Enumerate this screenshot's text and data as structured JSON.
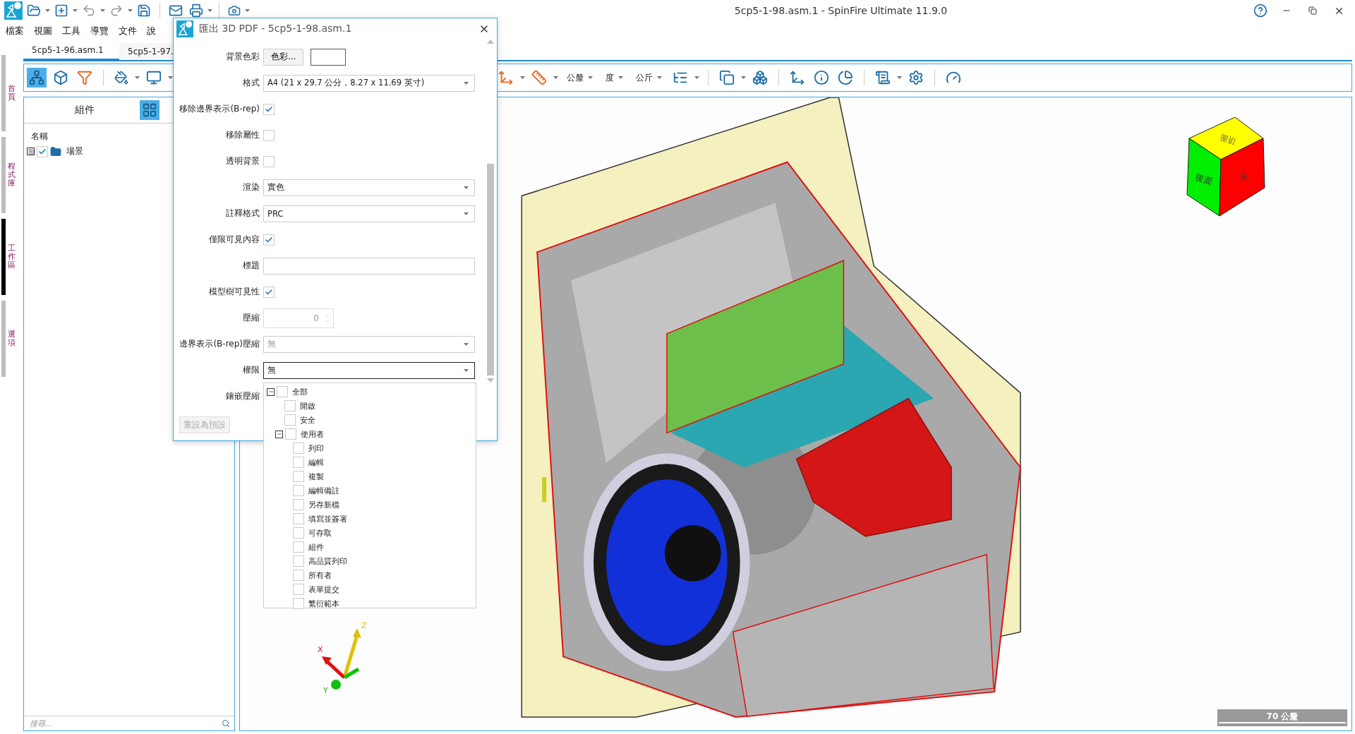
{
  "title_bar": {
    "title": "5cp5-1-98.asm.1 - SpinFire Ultimate 11.9.0"
  },
  "menu": [
    {
      "label": "檔案"
    },
    {
      "label": "視圖"
    },
    {
      "label": "工具"
    },
    {
      "label": "導覽"
    },
    {
      "label": "文件"
    },
    {
      "label": "說"
    }
  ],
  "side_tabs": [
    {
      "label": "首頁",
      "selected": false
    },
    {
      "label": "程式庫",
      "selected": false
    },
    {
      "label": "工作區",
      "selected": true
    },
    {
      "label": "選項",
      "selected": false
    }
  ],
  "document_tabs": [
    {
      "label": "5cp5-1-96.asm.1",
      "selected": true
    },
    {
      "label": "5cp5-1-97.",
      "selected": false
    }
  ],
  "toolbar": {
    "units": [
      "公釐",
      "度",
      "公斤"
    ]
  },
  "assembly_panel": {
    "title": "組件",
    "column": "名稱",
    "tree": [
      {
        "label": "場景",
        "checked": true,
        "expanded": false
      }
    ],
    "search": {
      "placeholder": "搜尋..."
    }
  },
  "viewport": {
    "view_cube": {
      "top": "頂面",
      "front": "後面",
      "side": "左"
    },
    "triad": {
      "x": "X",
      "y": "Y",
      "z": "Z"
    },
    "scale_bar": "70 公釐"
  },
  "dialog": {
    "title": "匯出 3D PDF - 5cp5-1-98.asm.1",
    "fields": [
      {
        "kind": "color",
        "label": "背景色彩",
        "button": "色彩..."
      },
      {
        "kind": "select",
        "label": "格式",
        "value": "A4 (21 x 29.7 公分，8.27 x 11.69 英寸)",
        "disabled": false,
        "open": false
      },
      {
        "kind": "checkbox",
        "label": "移除邊界表示(B-rep)",
        "checked": true
      },
      {
        "kind": "checkbox",
        "label": "移除屬性",
        "checked": false
      },
      {
        "kind": "checkbox",
        "label": "透明背景",
        "checked": false
      },
      {
        "kind": "select",
        "label": "渲染",
        "value": "實色",
        "disabled": false,
        "open": false
      },
      {
        "kind": "select",
        "label": "註釋格式",
        "value": "PRC",
        "disabled": false,
        "open": false
      },
      {
        "kind": "checkbox",
        "label": "僅限可見內容",
        "checked": true
      },
      {
        "kind": "text",
        "label": "標題"
      },
      {
        "kind": "checkbox",
        "label": "模型樹可見性",
        "checked": true
      },
      {
        "kind": "spin",
        "label": "壓縮",
        "value": "0",
        "disabled": true
      },
      {
        "kind": "select",
        "label": "邊界表示(B-rep)壓縮",
        "value": "無",
        "disabled": true,
        "open": false
      },
      {
        "kind": "select",
        "label": "權限",
        "value": "無",
        "disabled": false,
        "open": true
      },
      {
        "kind": "label",
        "label": "鑲嵌壓縮"
      }
    ],
    "reset_button": {
      "label": "重設為預設",
      "disabled": true
    },
    "permissions_tree": [
      {
        "label": "全部",
        "checked": false,
        "expanded": true,
        "children": [
          {
            "label": "開啟",
            "checked": false
          },
          {
            "label": "安全",
            "checked": false
          },
          {
            "label": "使用者",
            "checked": false,
            "expanded": true,
            "children": [
              {
                "label": "列印",
                "checked": false
              },
              {
                "label": "編輯",
                "checked": false
              },
              {
                "label": "複製",
                "checked": false
              },
              {
                "label": "編輯備註",
                "checked": false
              },
              {
                "label": "另存新檔",
                "checked": false
              },
              {
                "label": "填寫並簽署",
                "checked": false
              },
              {
                "label": "可存取",
                "checked": false
              },
              {
                "label": "組件",
                "checked": false
              },
              {
                "label": "高品質列印",
                "checked": false
              },
              {
                "label": "所有者",
                "checked": false
              },
              {
                "label": "表單提交",
                "checked": false
              },
              {
                "label": "繁衍範本",
                "checked": false
              }
            ]
          }
        ]
      }
    ]
  }
}
